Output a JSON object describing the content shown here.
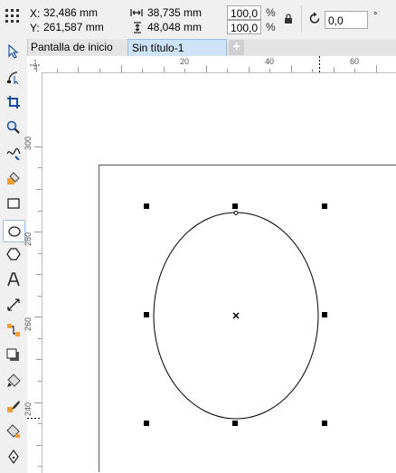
{
  "propbar": {
    "x_label": "X:",
    "x_value": "32,486 mm",
    "y_label": "Y:",
    "y_value": "261,587 mm",
    "width_value": "38,735 mm",
    "height_value": "48,048 mm",
    "scale_w": "100,0",
    "scale_h": "100,0",
    "pct_symbol_1": "%",
    "pct_symbol_2": "%",
    "rotation_value": "0,0",
    "degree_symbol": "°"
  },
  "tabs": [
    {
      "label": "Pantalla de inicio"
    },
    {
      "label": "Sin título-1"
    }
  ],
  "new_tab_symbol": "+",
  "hruler": {
    "ticks": [
      "20",
      "40",
      "60"
    ]
  },
  "vruler": {
    "ticks": [
      "300",
      "280",
      "260",
      "240"
    ]
  },
  "colors": {
    "active_tab": "#cfe3f7",
    "selection_handle": "#000000",
    "ruler_text": "#555555"
  }
}
